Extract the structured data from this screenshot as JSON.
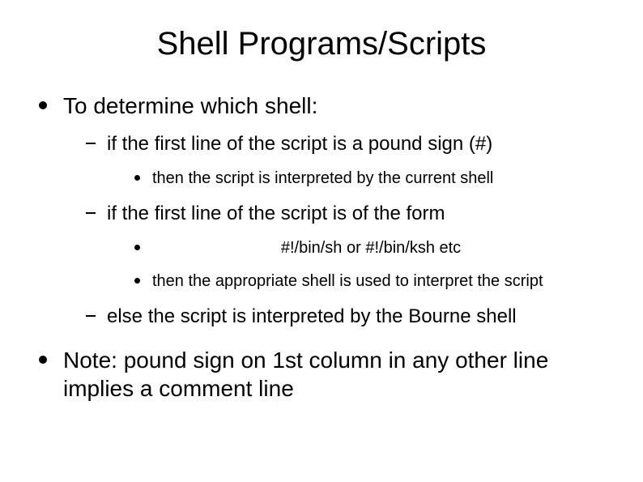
{
  "slide": {
    "title": "Shell Programs/Scripts",
    "bullets": [
      {
        "text": "To determine which shell:",
        "children": [
          {
            "text": "if the first line of the script is a pound sign (#)",
            "children": [
              {
                "text": "then the script is interpreted by the current shell"
              }
            ]
          },
          {
            "text": "if the first line of the script is of the form",
            "children": [
              {
                "text": "#!/bin/sh or #!/bin/ksh etc",
                "centered": true
              },
              {
                "text": "then the appropriate shell is used to interpret the script"
              }
            ]
          },
          {
            "text": "else the script is interpreted by the Bourne shell"
          }
        ]
      },
      {
        "text": "Note: pound sign on 1st column in any other line implies a comment line"
      }
    ]
  }
}
